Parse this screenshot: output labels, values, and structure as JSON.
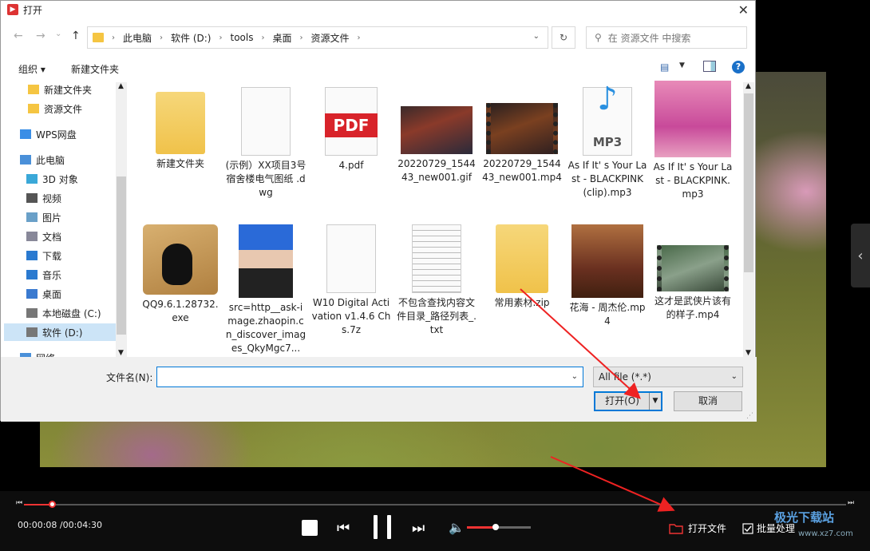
{
  "dialog": {
    "title": "打开",
    "close": "✕",
    "nav": {
      "back": "←",
      "forward": "→",
      "down": "⌄",
      "up": "↑",
      "refresh": "↻"
    },
    "breadcrumb": [
      "此电脑",
      "软件 (D:)",
      "tools",
      "桌面",
      "资源文件"
    ],
    "search_placeholder": "在 资源文件 中搜索",
    "toolbar": {
      "organize": "组织 ▾",
      "new_folder": "新建文件夹"
    },
    "sidebar": [
      {
        "label": "新建文件夹",
        "icon": "folder-icon"
      },
      {
        "label": "资源文件",
        "icon": "folder-icon"
      },
      {
        "label": "WPS网盘",
        "icon": "cloud-icon"
      },
      {
        "label": "此电脑",
        "icon": "computer-icon"
      },
      {
        "label": "3D 对象",
        "icon": "cube-icon"
      },
      {
        "label": "视频",
        "icon": "video-icon"
      },
      {
        "label": "图片",
        "icon": "picture-icon"
      },
      {
        "label": "文档",
        "icon": "document-icon"
      },
      {
        "label": "下载",
        "icon": "download-icon"
      },
      {
        "label": "音乐",
        "icon": "music-icon"
      },
      {
        "label": "桌面",
        "icon": "desktop-icon"
      },
      {
        "label": "本地磁盘 (C:)",
        "icon": "drive-icon"
      },
      {
        "label": "软件 (D:)",
        "icon": "drive-icon"
      },
      {
        "label": "网络",
        "icon": "network-icon"
      }
    ],
    "files": [
      {
        "name": "新建文件夹",
        "kind": "folder"
      },
      {
        "name": "(示例）XX项目3号宿舍楼电气图纸 .dwg",
        "kind": "blank"
      },
      {
        "name": "4.pdf",
        "kind": "pdf",
        "badge": "PDF"
      },
      {
        "name": "20220729_154443_new001.gif",
        "kind": "image-dark"
      },
      {
        "name": "20220729_154443_new001.mp4",
        "kind": "video-dark"
      },
      {
        "name": "As If It' s Your Last - BLACKPINK (clip).mp3",
        "kind": "mp3",
        "badge": "MP3"
      },
      {
        "name": "As If It' s Your Last - BLACKPINK.mp3",
        "kind": "pink"
      },
      {
        "name": "QQ9.6.1.28732.exe",
        "kind": "qq"
      },
      {
        "name": "src=http__ask-image.zhaopin.cn_discover_images_QkyMgc7...",
        "kind": "photo"
      },
      {
        "name": "W10 Digital Activation v1.4.6 Chs.7z",
        "kind": "blank"
      },
      {
        "name": "不包含查找内容文件目录_路径列表_.txt",
        "kind": "text"
      },
      {
        "name": "常用素材.zip",
        "kind": "zip"
      },
      {
        "name": "花海 - 周杰伦.mp4",
        "kind": "poster"
      },
      {
        "name": "这才是武侠片该有的样子.mp4",
        "kind": "film"
      }
    ],
    "filename_label": "文件名(N):",
    "filename_value": "",
    "filetype": "All file (*.*)",
    "open_button": "打开(O)",
    "cancel_button": "取消"
  },
  "player": {
    "time": "00:00:08 /00:04:30",
    "progress": 0.034,
    "volume": 0.45,
    "open_file": "打开文件",
    "batch": "批量处理",
    "watermark": "极光下载站",
    "watermark_sub": "www.xz7.com"
  }
}
